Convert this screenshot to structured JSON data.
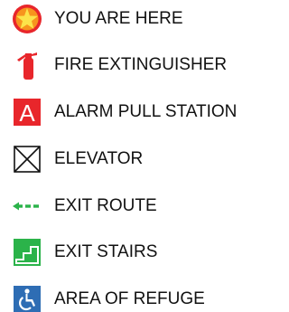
{
  "legend": {
    "items": [
      {
        "icon": "star-in-circle-icon",
        "label": "YOU ARE HERE",
        "color": "#F7941D",
        "accent": "#E8262B"
      },
      {
        "icon": "fire-extinguisher-icon",
        "label": "FIRE EXTINGUISHER",
        "color": "#E8262B"
      },
      {
        "icon": "alarm-pull-station-icon",
        "label": "ALARM PULL STATION",
        "color": "#E8262B",
        "glyph": "A"
      },
      {
        "icon": "elevator-icon",
        "label": "ELEVATOR",
        "color": "#111111"
      },
      {
        "icon": "exit-route-arrow-icon",
        "label": "EXIT ROUTE",
        "color": "#2BB34A"
      },
      {
        "icon": "exit-stairs-icon",
        "label": "EXIT STAIRS",
        "color": "#2BB34A"
      },
      {
        "icon": "wheelchair-accessible-icon",
        "label": "AREA OF REFUGE",
        "color": "#2E6DB4"
      }
    ]
  }
}
